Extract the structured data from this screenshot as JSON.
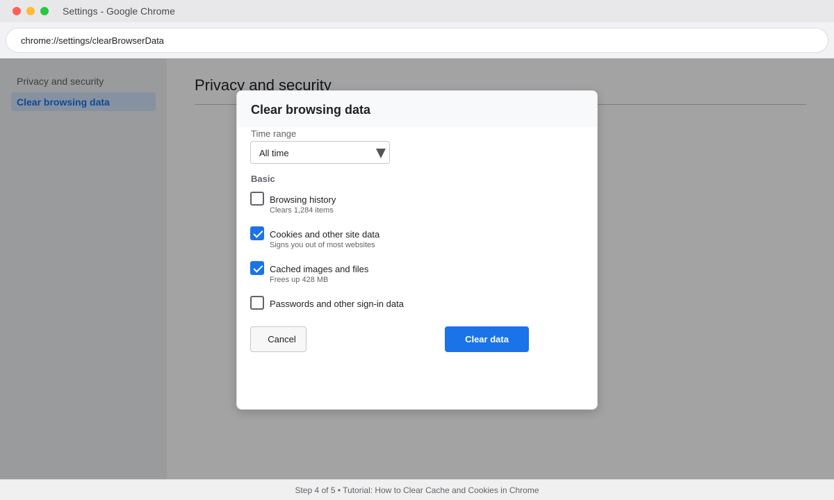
{
  "window": {
    "title": "Settings - Google Chrome"
  },
  "address_bar": {
    "url": "chrome://settings/clearBrowserData"
  },
  "sidebar": {
    "items": [
      {
        "label": "Privacy and security"
      },
      {
        "label": "Clear browsing data"
      }
    ]
  },
  "page": {
    "title": "Privacy and security"
  },
  "dialog": {
    "title": "Clear browsing data",
    "time_range": {
      "label": "Time range",
      "value": "All time"
    },
    "section_label": "Basic",
    "options": [
      {
        "label": "Browsing history",
        "sublabel": "Clears 1,284 items",
        "checked": false
      },
      {
        "label": "Cookies and other site data",
        "sublabel": "Signs you out of most websites",
        "checked": true
      },
      {
        "label": "Cached images and files",
        "sublabel": "Frees up 428 MB",
        "checked": true
      },
      {
        "label": "Passwords and other sign-in data",
        "sublabel": "",
        "checked": false
      }
    ],
    "cancel_label": "Cancel",
    "confirm_label": "Clear data"
  },
  "footer": {
    "caption": "Step 4 of 5 • Tutorial: How to Clear Cache and Cookies in Chrome"
  },
  "colors": {
    "accent": "#1a73e8",
    "checkbox_checked": "#1a73e8"
  },
  "icons": {
    "close": "red",
    "minimize": "yellow",
    "maximize": "green",
    "dropdown": "caret-down-icon",
    "check": "check-icon"
  }
}
